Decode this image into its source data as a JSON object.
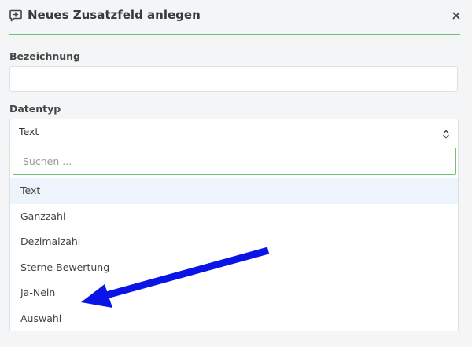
{
  "dialog": {
    "title": "Neues Zusatzfeld anlegen",
    "title_icon": "comment-plus-icon",
    "close_icon": "close-icon",
    "accent_color": "#6cc46e"
  },
  "form": {
    "name_label": "Bezeichnung",
    "name_value": "",
    "type_label": "Datentyp",
    "type_value": "Text",
    "search_placeholder": "Suchen ...",
    "options": [
      "Text",
      "Ganzzahl",
      "Dezimalzahl",
      "Sterne-Bewertung",
      "Ja-Nein",
      "Auswahl"
    ],
    "selected_option": "Text"
  },
  "annotation": {
    "arrow_color": "#0a14e6",
    "points_to": "Auswahl"
  }
}
